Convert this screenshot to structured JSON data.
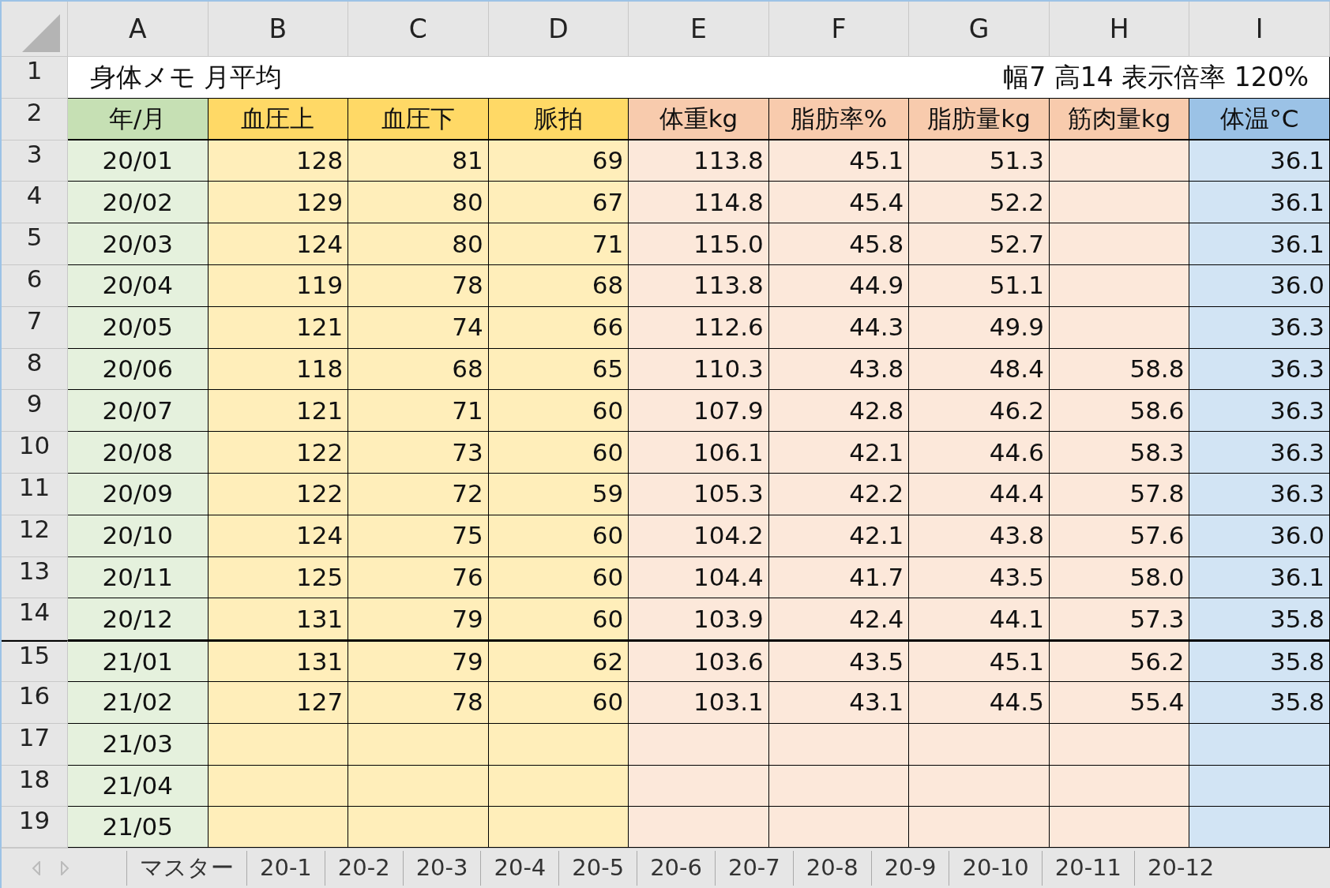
{
  "columns": [
    {
      "letter": "A",
      "header": "年/月",
      "color": "#c6e0b4"
    },
    {
      "letter": "B",
      "header": "血圧上",
      "color": "#ffd966"
    },
    {
      "letter": "C",
      "header": "血圧下",
      "color": "#ffd966"
    },
    {
      "letter": "D",
      "header": "脈拍",
      "color": "#ffd966"
    },
    {
      "letter": "E",
      "header": "体重kg",
      "color": "#f8cbad"
    },
    {
      "letter": "F",
      "header": "脂肪率%",
      "color": "#f8cbad"
    },
    {
      "letter": "G",
      "header": "脂肪量kg",
      "color": "#f8cbad"
    },
    {
      "letter": "H",
      "header": "筋肉量kg",
      "color": "#f8cbad"
    },
    {
      "letter": "I",
      "header": "体温°C",
      "color": "#9bc2e6"
    }
  ],
  "title_row": {
    "number": "1",
    "title": "身体メモ 月平均",
    "note": "幅7 高14 表示倍率 120%"
  },
  "header_row_number": "2",
  "rows": [
    {
      "number": "3",
      "cells": [
        "20/01",
        "128",
        "81",
        "69",
        "113.8",
        "45.1",
        "51.3",
        null,
        "36.1"
      ]
    },
    {
      "number": "4",
      "cells": [
        "20/02",
        "129",
        "80",
        "67",
        "114.8",
        "45.4",
        "52.2",
        null,
        "36.1"
      ]
    },
    {
      "number": "5",
      "cells": [
        "20/03",
        "124",
        "80",
        "71",
        "115.0",
        "45.8",
        "52.7",
        null,
        "36.1"
      ]
    },
    {
      "number": "6",
      "cells": [
        "20/04",
        "119",
        "78",
        "68",
        "113.8",
        "44.9",
        "51.1",
        null,
        "36.0"
      ]
    },
    {
      "number": "7",
      "cells": [
        "20/05",
        "121",
        "74",
        "66",
        "112.6",
        "44.3",
        "49.9",
        null,
        "36.3"
      ]
    },
    {
      "number": "8",
      "cells": [
        "20/06",
        "118",
        "68",
        "65",
        "110.3",
        "43.8",
        "48.4",
        "58.8",
        "36.3"
      ]
    },
    {
      "number": "9",
      "cells": [
        "20/07",
        "121",
        "71",
        "60",
        "107.9",
        "42.8",
        "46.2",
        "58.6",
        "36.3"
      ]
    },
    {
      "number": "10",
      "cells": [
        "20/08",
        "122",
        "73",
        "60",
        "106.1",
        "42.1",
        "44.6",
        "58.3",
        "36.3"
      ]
    },
    {
      "number": "11",
      "cells": [
        "20/09",
        "122",
        "72",
        "59",
        "105.3",
        "42.2",
        "44.4",
        "57.8",
        "36.3"
      ]
    },
    {
      "number": "12",
      "cells": [
        "20/10",
        "124",
        "75",
        "60",
        "104.2",
        "42.1",
        "43.8",
        "57.6",
        "36.0"
      ]
    },
    {
      "number": "13",
      "cells": [
        "20/11",
        "125",
        "76",
        "60",
        "104.4",
        "41.7",
        "43.5",
        "58.0",
        "36.1"
      ]
    },
    {
      "number": "14",
      "cells": [
        "20/12",
        "131",
        "79",
        "60",
        "103.9",
        "42.4",
        "44.1",
        "57.3",
        "35.8"
      ]
    },
    {
      "number": "15",
      "thick_border_above": true,
      "cells": [
        "21/01",
        "131",
        "79",
        "62",
        "103.6",
        "43.5",
        "45.1",
        "56.2",
        "35.8"
      ]
    },
    {
      "number": "16",
      "cells": [
        "21/02",
        "127",
        "78",
        "60",
        "103.1",
        "43.1",
        "44.5",
        "55.4",
        "35.8"
      ]
    },
    {
      "number": "17",
      "cells": [
        "21/03",
        null,
        null,
        null,
        null,
        null,
        null,
        null,
        null
      ]
    },
    {
      "number": "18",
      "cells": [
        "21/04",
        null,
        null,
        null,
        null,
        null,
        null,
        null,
        null
      ]
    },
    {
      "number": "19",
      "cells": [
        "21/05",
        null,
        null,
        null,
        null,
        null,
        null,
        null,
        null
      ]
    }
  ],
  "sheet_tabs": [
    "マスター",
    "20-1",
    "20-2",
    "20-3",
    "20-4",
    "20-5",
    "20-6",
    "20-7",
    "20-8",
    "20-9",
    "20-10",
    "20-11",
    "20-12"
  ]
}
